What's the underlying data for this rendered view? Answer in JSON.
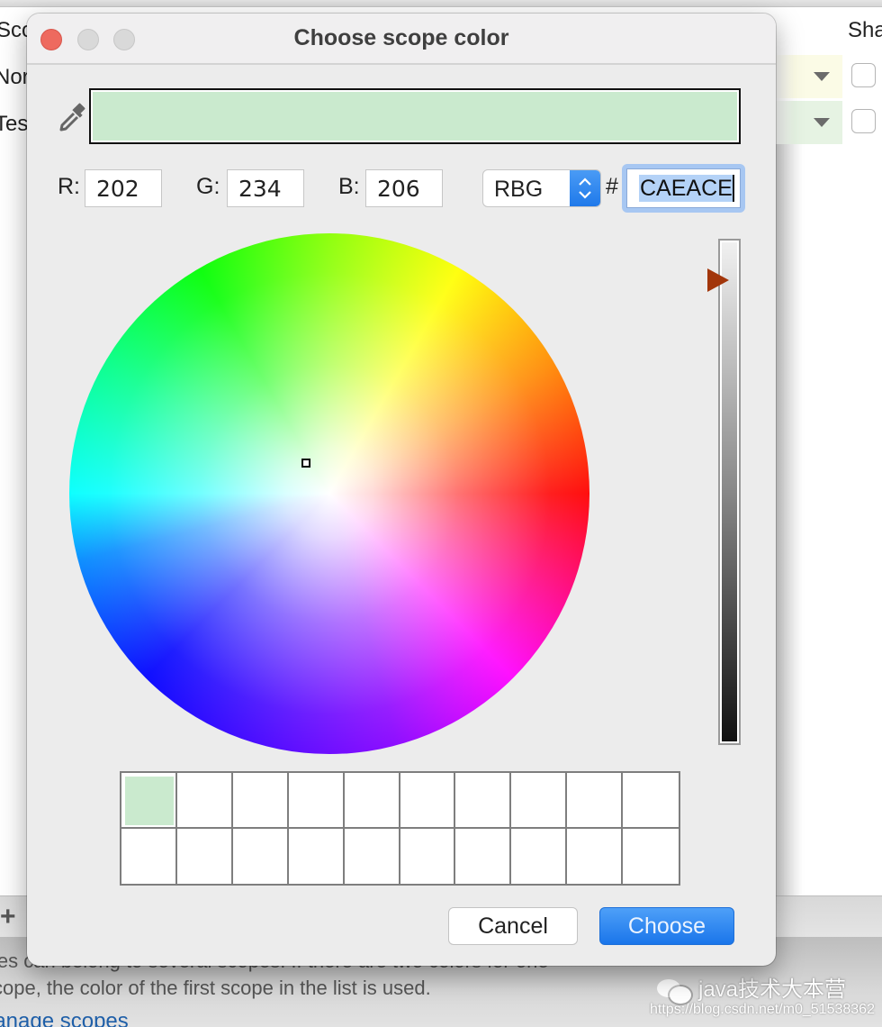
{
  "background_window": {
    "columns": {
      "scope_partial": "Sco",
      "share_partial": "Sha"
    },
    "rows": [
      {
        "name_partial": "Nor",
        "color": "#fbfbe6",
        "shared": false
      },
      {
        "name_partial": "Tes",
        "color": "#e6f3e3",
        "shared": false
      }
    ],
    "add_button": "+",
    "footer_line_1": "les can belong to several scopes. If there are two colors for one",
    "footer_line_2": "cope, the color of the first scope in the list is used.",
    "footer_link": "lanage scopes"
  },
  "watermark": {
    "label": "java技术大本营",
    "url": "https://blog.csdn.net/m0_51538362"
  },
  "dialog": {
    "title": "Choose scope color",
    "selected_color": "#CAEACE",
    "rgb": {
      "r_label": "R:",
      "r_value": "202",
      "g_label": "G:",
      "g_value": "234",
      "b_label": "B:",
      "b_value": "206"
    },
    "mode": "RBG",
    "hash_label": "#",
    "hex_value": "CAEACE",
    "brightness_level": 0.92,
    "recent_colors": [
      "#CAEACE",
      "",
      "",
      "",
      "",
      "",
      "",
      "",
      "",
      "",
      "",
      "",
      "",
      "",
      "",
      "",
      "",
      "",
      "",
      ""
    ],
    "buttons": {
      "cancel": "Cancel",
      "choose": "Choose"
    },
    "accent_color": "#1F79EA",
    "slider_thumb_color": "#A2360B"
  }
}
